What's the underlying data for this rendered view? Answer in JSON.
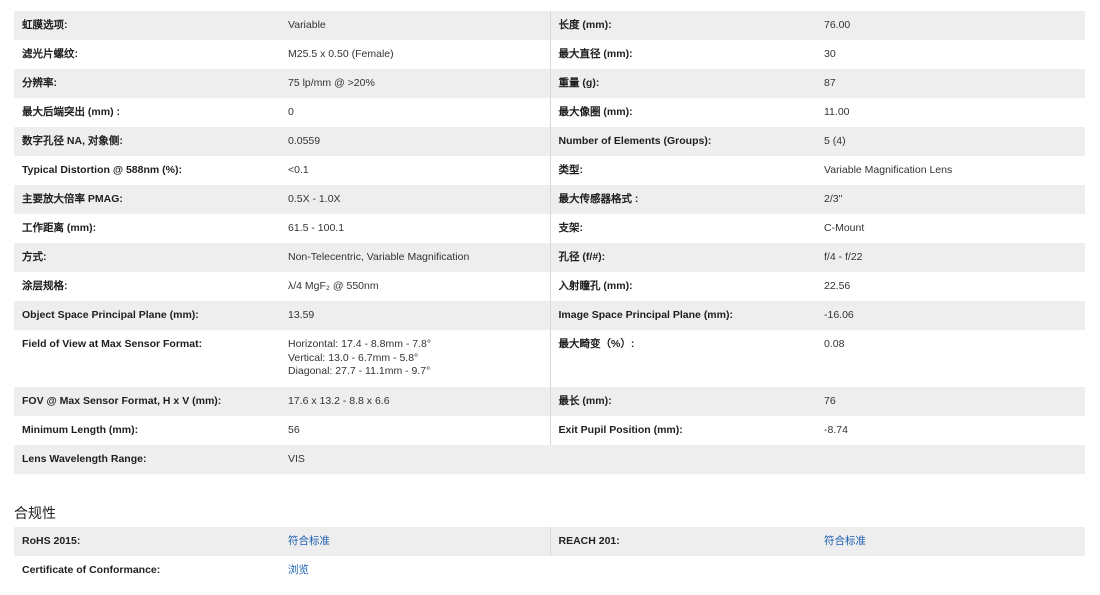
{
  "specs": [
    {
      "l1": "虹膜选项:",
      "v1": "Variable",
      "l2": "长度 (mm):",
      "v2": "76.00"
    },
    {
      "l1": "滤光片螺纹:",
      "v1": "M25.5 x 0.50 (Female)",
      "l2": "最大直径 (mm):",
      "v2": "30"
    },
    {
      "l1": "分辨率:",
      "v1": "75 lp/mm @ >20%",
      "l2": "重量 (g):",
      "v2": "87"
    },
    {
      "l1": "最大后端突出 (mm) :",
      "v1": "0",
      "l2": "最大像圈 (mm):",
      "v2": "11.00"
    },
    {
      "l1": "数字孔径 NA, 对象侧:",
      "v1": "0.0559",
      "l2": "Number of Elements (Groups):",
      "v2": "5 (4)"
    },
    {
      "l1": "Typical Distortion @ 588nm (%):",
      "v1": "<0.1",
      "l2": "类型:",
      "v2": "Variable Magnification Lens"
    },
    {
      "l1": "主要放大倍率 PMAG:",
      "v1": "0.5X - 1.0X",
      "l2": "最大传感器格式 :",
      "v2": "2/3\""
    },
    {
      "l1": "工作距离 (mm):",
      "v1": "61.5 - 100.1",
      "l2": "支架:",
      "v2": "C-Mount"
    },
    {
      "l1": "方式:",
      "v1": "Non-Telecentric, Variable Magnification",
      "l2": "孔径 (f/#):",
      "v2": "f/4 - f/22"
    },
    {
      "l1": "涂层规格:",
      "v1": "λ/4 MgF₂ @ 550nm",
      "l2": "入射瞳孔 (mm):",
      "v2": "22.56"
    },
    {
      "l1": "Object Space Principal Plane (mm):",
      "v1": "13.59",
      "l2": "Image Space Principal Plane (mm):",
      "v2": "-16.06"
    },
    {
      "l1": "Field of View at Max Sensor Format:",
      "v1_lines": [
        "Horizontal: 17.4 - 8.8mm - 7.8°",
        "Vertical: 13.0 - 6.7mm - 5.8°",
        "Diagonal: 27.7 - 11.1mm - 9.7°"
      ],
      "l2": "最大畸变（%）:",
      "v2": "0.08"
    },
    {
      "l1": "FOV @ Max Sensor Format, H x V (mm):",
      "v1": "17.6 x 13.2 - 8.8 x 6.6",
      "l2": "最长 (mm):",
      "v2": "76"
    },
    {
      "l1": "Minimum Length (mm):",
      "v1": "56",
      "l2": "Exit Pupil Position (mm):",
      "v2": "-8.74"
    },
    {
      "l1": "Lens Wavelength Range:",
      "v1": "VIS",
      "l2": "",
      "v2": ""
    }
  ],
  "compliance": {
    "title": "合规性",
    "rows": [
      {
        "l1": "RoHS 2015:",
        "v1": "符合标准",
        "l2": "REACH 201:",
        "v2": "符合标准"
      },
      {
        "l1": "Certificate of Conformance:",
        "v1": "浏览",
        "l2": "",
        "v2": ""
      }
    ]
  },
  "colors": {
    "row_alt": "#eeeeee",
    "link": "#1a5fb4"
  }
}
